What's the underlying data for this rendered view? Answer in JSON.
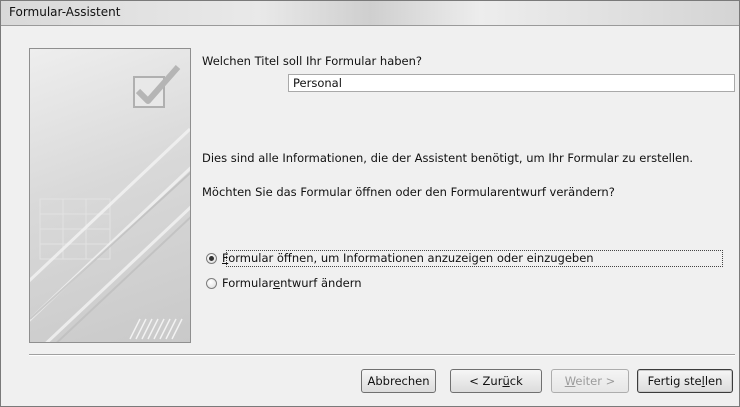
{
  "window": {
    "title": "Formular-Assistent"
  },
  "prompt": {
    "title_question": "Welchen Titel soll Ihr Formular haben?"
  },
  "title_field": {
    "value": "Personal"
  },
  "info_text": "Dies sind alle Informationen, die der Assistent benötigt, um Ihr Formular zu erstellen.",
  "question_text": "Möchten Sie das Formular öffnen oder den Formularentwurf verändern?",
  "options": [
    {
      "pre": "",
      "mnemonic": "F",
      "post": "ormular öffnen, um Informationen anzuzeigen oder einzugeben",
      "selected": true
    },
    {
      "pre": "Formular",
      "mnemonic": "e",
      "post": "ntwurf ändern",
      "selected": false
    }
  ],
  "buttons": {
    "cancel": {
      "label": "Abbrechen"
    },
    "back": {
      "pre": "< Zur",
      "mnemonic": "ü",
      "post": "ck"
    },
    "next": {
      "pre": "",
      "mnemonic": "W",
      "post": "eiter >",
      "disabled": true
    },
    "finish": {
      "pre": "Fertig ste",
      "mnemonic": "l",
      "post": "len"
    }
  },
  "icons": {
    "wizard_art": "checkmark-form-icon"
  }
}
